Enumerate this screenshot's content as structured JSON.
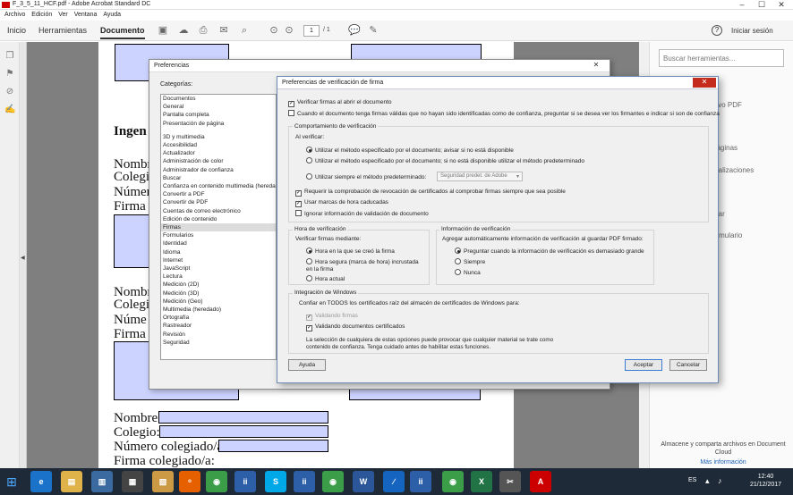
{
  "window": {
    "title": "F_3_5_11_HCF.pdf - Adobe Acrobat Standard DC",
    "controls": [
      "–",
      "☐",
      "✕"
    ]
  },
  "menubar": [
    "Archivo",
    "Edición",
    "Ver",
    "Ventana",
    "Ayuda"
  ],
  "apptoolbar": {
    "tabs": [
      "Inicio",
      "Herramientas",
      "Documento"
    ],
    "page_current": "1",
    "page_total": "/ 1",
    "help": "?",
    "login": "Iniciar sesión"
  },
  "document": {
    "heading": "Ingen",
    "block1": [
      "Nombr",
      "Colegi",
      "Número",
      "Firma c"
    ],
    "block2": [
      "Nombr",
      "Colegi",
      "Núme",
      "Firma c"
    ],
    "block3": [
      "Nombre:",
      "Colegio:",
      "Número colegiado/a:",
      "Firma colegiado/a:"
    ]
  },
  "rightpanel": {
    "search_placeholder": "Buscar herramientas...",
    "partial_items": [
      "hivo PDF",
      "páginas",
      "ntalizaciones",
      "mar",
      "ormulario"
    ],
    "cloud_text": "Almacene y comparta archivos en Document Cloud",
    "more_info": "Más información"
  },
  "preferences": {
    "title": "Preferencias",
    "close": "✕",
    "categories_label": "Categorías:",
    "categories_top": [
      "Documentos",
      "General",
      "Pantalla completa",
      "Presentación de página"
    ],
    "categories": [
      "3D y multimedia",
      "Accesibilidad",
      "Actualizador",
      "Administración de color",
      "Administrador de confianza",
      "Buscar",
      "Confianza en contenido multimedia (heredado)",
      "Convertir a PDF",
      "Convertir de PDF",
      "Cuentas de correo electrónico",
      "Edición de contenido",
      "Firmas",
      "Formularios",
      "Identidad",
      "Idioma",
      "Internet",
      "JavaScript",
      "Lectura",
      "Medición (2D)",
      "Medición (3D)",
      "Medición (Geo)",
      "Multimedia (heredado)",
      "Ortografía",
      "Rastreador",
      "Revisión",
      "Seguridad"
    ],
    "selected": "Firmas"
  },
  "sigdialog": {
    "title": "Preferencias de verificación de firma",
    "close": "✕",
    "verify_on_open": "Verificar firmas al abrir el documento",
    "untrusted_prompt": "Cuando el documento tenga firmas válidas que no hayan sido identificadas como de confianza, preguntar si se desea ver los firmantes e indicar si son de confianza",
    "behavior_title": "Comportamiento de verificación",
    "al_verificar": "Al verificar:",
    "method_1": "Utilizar el método especificado por el documento; avisar si no está disponible",
    "method_2": "Utilizar el método especificado por el documento; si no está disponible utilizar el método predeterminado",
    "method_3": "Utilizar siempre el método predeterminado:",
    "method_select": "Seguridad predet. de Adobe",
    "revocation": "Requerir la comprobación de revocación de certificados al comprobar firmas siempre que sea posible",
    "expired_timestamps": "Usar marcas de hora caducadas",
    "ignore_validation": "Ignorar información de validación de documento",
    "time_title": "Hora de verificación",
    "time_label": "Verificar firmas mediante:",
    "time_1": "Hora en la que se creó la firma",
    "time_2": "Hora segura (marca de hora) incrustada en la firma",
    "time_3": "Hora actual",
    "info_title": "Información de verificación",
    "info_label": "Agregar automáticamente información de verificación al guardar PDF firmado:",
    "info_1": "Preguntar cuando la información de verificación es demasiado grande",
    "info_2": "Siempre",
    "info_3": "Nunca",
    "win_title": "Integración de Windows",
    "win_label": "Confiar en TODOS los certificados raíz del almacén de certificados de Windows para:",
    "win_1": "Validando firmas",
    "win_2": "Validando documentos certificados",
    "win_note": "La selección de cualquiera de estas opciones puede provocar que cualquier material se trate como contenido de confianza. Tenga cuidado antes de habilitar estas funciones.",
    "btn_help": "Ayuda",
    "btn_ok": "Aceptar",
    "btn_cancel": "Cancelar"
  },
  "taskbar": {
    "lang": "ES",
    "time": "12:40",
    "date": "21/12/2017"
  }
}
